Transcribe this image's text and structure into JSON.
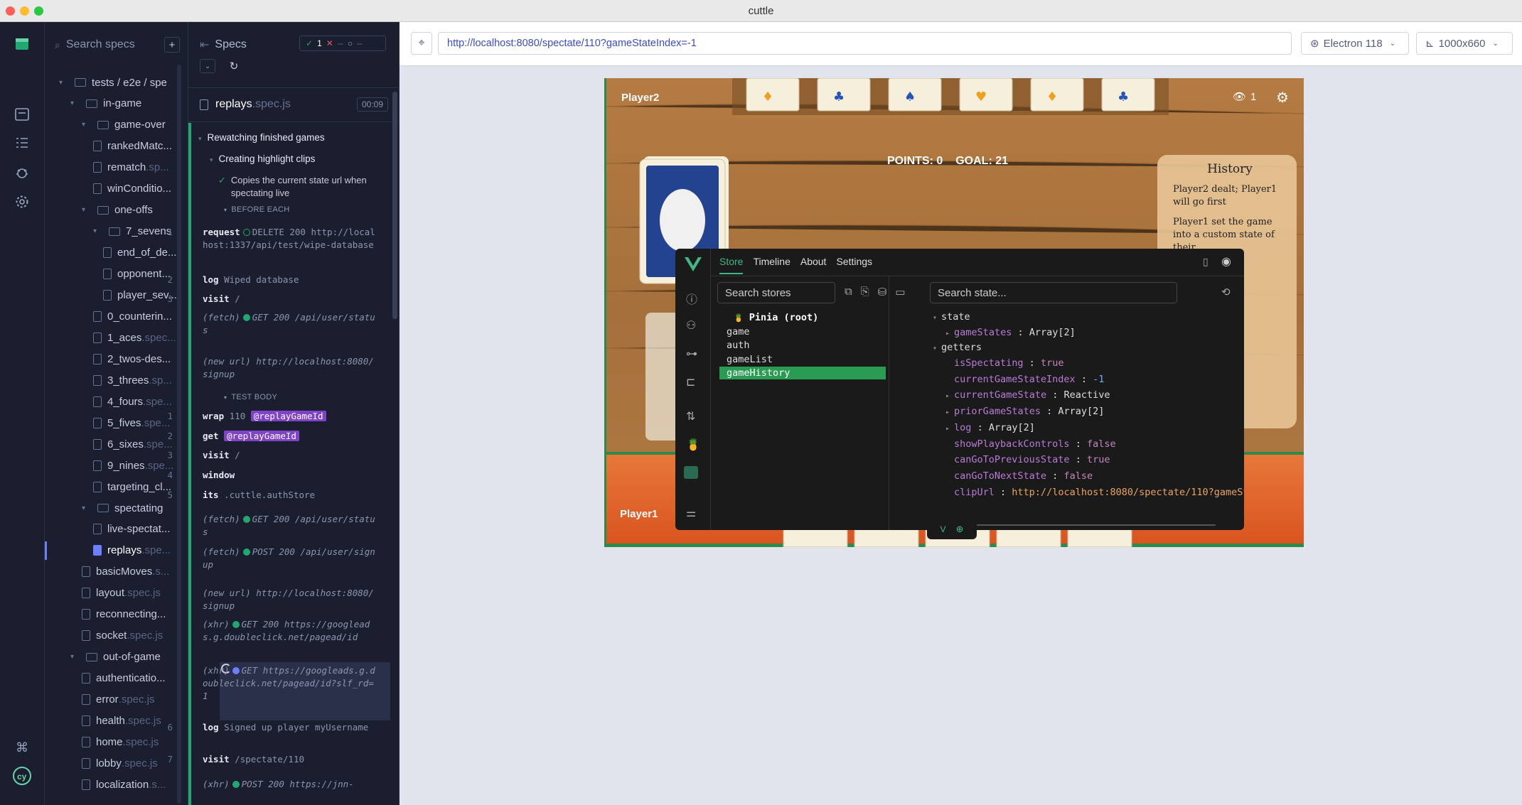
{
  "window": {
    "title": "cuttle"
  },
  "nav": {
    "icons": [
      "specs-icon",
      "runs-icon",
      "debug-icon",
      "settings-icon",
      "keyboard-icon",
      "cypress-logo"
    ]
  },
  "specs_panel": {
    "search_placeholder": "Search specs",
    "add": "+",
    "tree": [
      {
        "label": "tests / e2e / spe",
        "ext": "",
        "kind": "folder",
        "depth": 0
      },
      {
        "label": "in-game",
        "ext": "",
        "kind": "folder",
        "depth": 1
      },
      {
        "label": "game-over",
        "ext": "",
        "kind": "folder",
        "depth": 2
      },
      {
        "label": "rankedMatc...",
        "ext": "",
        "kind": "file",
        "depth": 3
      },
      {
        "label": "rematch",
        "ext": ".sp...",
        "kind": "file",
        "depth": 3
      },
      {
        "label": "winConditio...",
        "ext": "",
        "kind": "file",
        "depth": 3
      },
      {
        "label": "one-offs",
        "ext": "",
        "kind": "folder",
        "depth": 2
      },
      {
        "label": "7_sevens",
        "ext": "",
        "kind": "folder",
        "depth": 3
      },
      {
        "label": "end_of_de...",
        "ext": "",
        "kind": "file",
        "depth": 4
      },
      {
        "label": "opponent...",
        "ext": "",
        "kind": "file",
        "depth": 4
      },
      {
        "label": "player_sev...",
        "ext": "",
        "kind": "file",
        "depth": 4
      },
      {
        "label": "0_counterin...",
        "ext": "",
        "kind": "file",
        "depth": 3
      },
      {
        "label": "1_aces",
        "ext": ".spec...",
        "kind": "file",
        "depth": 3
      },
      {
        "label": "2_twos-des...",
        "ext": "",
        "kind": "file",
        "depth": 3
      },
      {
        "label": "3_threes",
        "ext": ".sp...",
        "kind": "file",
        "depth": 3
      },
      {
        "label": "4_fours",
        "ext": ".spe...",
        "kind": "file",
        "depth": 3
      },
      {
        "label": "5_fives",
        "ext": ".spe...",
        "kind": "file",
        "depth": 3
      },
      {
        "label": "6_sixes",
        "ext": ".spe...",
        "kind": "file",
        "depth": 3
      },
      {
        "label": "9_nines",
        "ext": ".spe...",
        "kind": "file",
        "depth": 3
      },
      {
        "label": "targeting_cl...",
        "ext": "",
        "kind": "file",
        "depth": 3
      },
      {
        "label": "spectating",
        "ext": "",
        "kind": "folder",
        "depth": 2
      },
      {
        "label": "live-spectat...",
        "ext": "",
        "kind": "file",
        "depth": 3
      },
      {
        "label": "replays",
        "ext": ".spe...",
        "kind": "file",
        "depth": 3,
        "active": true
      },
      {
        "label": "basicMoves",
        "ext": ".s...",
        "kind": "file",
        "depth": 2
      },
      {
        "label": "layout",
        "ext": ".spec.js",
        "kind": "file",
        "depth": 2
      },
      {
        "label": "reconnecting...",
        "ext": "",
        "kind": "file",
        "depth": 2
      },
      {
        "label": "socket",
        "ext": ".spec.js",
        "kind": "file",
        "depth": 2
      },
      {
        "label": "out-of-game",
        "ext": "",
        "kind": "folder",
        "depth": 1
      },
      {
        "label": "authenticatio...",
        "ext": "",
        "kind": "file",
        "depth": 2
      },
      {
        "label": "error",
        "ext": ".spec.js",
        "kind": "file",
        "depth": 2
      },
      {
        "label": "health",
        "ext": ".spec.js",
        "kind": "file",
        "depth": 2
      },
      {
        "label": "home",
        "ext": ".spec.js",
        "kind": "file",
        "depth": 2
      },
      {
        "label": "lobby",
        "ext": ".spec.js",
        "kind": "file",
        "depth": 2
      },
      {
        "label": "localization",
        "ext": ".s...",
        "kind": "file",
        "depth": 2
      }
    ]
  },
  "reporter": {
    "title": "Specs",
    "passed": "1",
    "failed": "--",
    "pending": "--",
    "spec_name": "replays",
    "spec_ext": ".spec.js",
    "duration": "00:09",
    "suite": "Rewatching finished games",
    "subsuite": "Creating highlight clips",
    "test": "Copies the current state url when spectating live",
    "before_each": "BEFORE EACH",
    "test_body": "TEST BODY",
    "before_cmds": [
      {
        "n": "1",
        "name": "request",
        "method": "DELETE 200",
        "detail": "http://localhost:1337/api/test/wipe-database"
      },
      {
        "n": "2",
        "name": "log",
        "detail": "Wiped database"
      },
      {
        "n": "3",
        "name": "visit",
        "detail": "/"
      },
      {
        "n": "",
        "name": "(fetch)",
        "method": "GET 200",
        "detail": "/api/user/status"
      },
      {
        "n": "",
        "name": "(new url)",
        "detail": "http://localhost:8080/signup"
      }
    ],
    "body_cmds": [
      {
        "n": "1",
        "name": "wrap",
        "detail": "110",
        "tag": "@replayGameId"
      },
      {
        "n": "2",
        "name": "get",
        "tag": "@replayGameId"
      },
      {
        "n": "3",
        "name": "visit",
        "detail": "/"
      },
      {
        "n": "4",
        "name": "window"
      },
      {
        "n": "5",
        "name": "its",
        "detail": ".cuttle.authStore"
      },
      {
        "n": "",
        "name": "(fetch)",
        "method": "GET 200",
        "detail": "/api/user/status"
      },
      {
        "n": "",
        "name": "(fetch)",
        "method": "POST 200",
        "detail": "/api/user/signup"
      },
      {
        "n": "",
        "name": "(new url)",
        "detail": "http://localhost:8080/signup"
      },
      {
        "n": "",
        "name": "(xhr)",
        "method": "GET 200",
        "detail": "https://googleads.g.doubleclick.net/pagead/id"
      },
      {
        "n": "",
        "name": "(xhr)",
        "method": "GET",
        "detail": "https://googleads.g.doubleclick.net/pagead/id?slf_rd=1"
      },
      {
        "n": "6",
        "name": "log",
        "detail": "Signed up player myUsername"
      },
      {
        "n": "7",
        "name": "visit",
        "detail": "/spectate/110"
      },
      {
        "n": "",
        "name": "(xhr)",
        "method": "POST 200",
        "detail": "https://jnn-"
      }
    ]
  },
  "browser": {
    "url": "http://localhost:8080/spectate/110?gameStateIndex=-1",
    "engine": "Electron 118",
    "viewport": "1000x660"
  },
  "game": {
    "player2": "Player2",
    "player1": "Player1",
    "spectators": "1",
    "points": "POINTS: 0",
    "goal": "GOAL: 21",
    "history_title": "History",
    "history": [
      "Player2 dealt; Player1 will go first",
      "Player1 set the game into a custom state of their"
    ]
  },
  "devtools": {
    "tabs": [
      "Store",
      "Timeline",
      "About",
      "Settings"
    ],
    "stores_placeholder": "Search stores",
    "state_placeholder": "Search state...",
    "stores": [
      "Pinia (root)",
      "game",
      "auth",
      "gameList",
      "gameHistory"
    ],
    "state_label": "state",
    "getters_label": "getters",
    "state_items": [
      {
        "k": "gameStates",
        "v": "Array[2]"
      }
    ],
    "getter_items": [
      {
        "k": "isSpectating",
        "v": "true",
        "t": "bool",
        "arrow": false
      },
      {
        "k": "currentGameStateIndex",
        "v": "-1",
        "t": "num",
        "arrow": false
      },
      {
        "k": "currentGameState",
        "v": "Reactive",
        "t": "plain",
        "arrow": true
      },
      {
        "k": "priorGameStates",
        "v": "Array[2]",
        "t": "plain",
        "arrow": true
      },
      {
        "k": "log",
        "v": "Array[2]",
        "t": "plain",
        "arrow": true
      },
      {
        "k": "showPlaybackControls",
        "v": "false",
        "t": "bool",
        "arrow": false
      },
      {
        "k": "canGoToPreviousState",
        "v": "true",
        "t": "bool",
        "arrow": false
      },
      {
        "k": "canGoToNextState",
        "v": "false",
        "t": "bool",
        "arrow": false
      },
      {
        "k": "clipUrl",
        "v": "http://localhost:8080/spectate/110?gameSt",
        "t": "str",
        "arrow": false
      }
    ]
  }
}
